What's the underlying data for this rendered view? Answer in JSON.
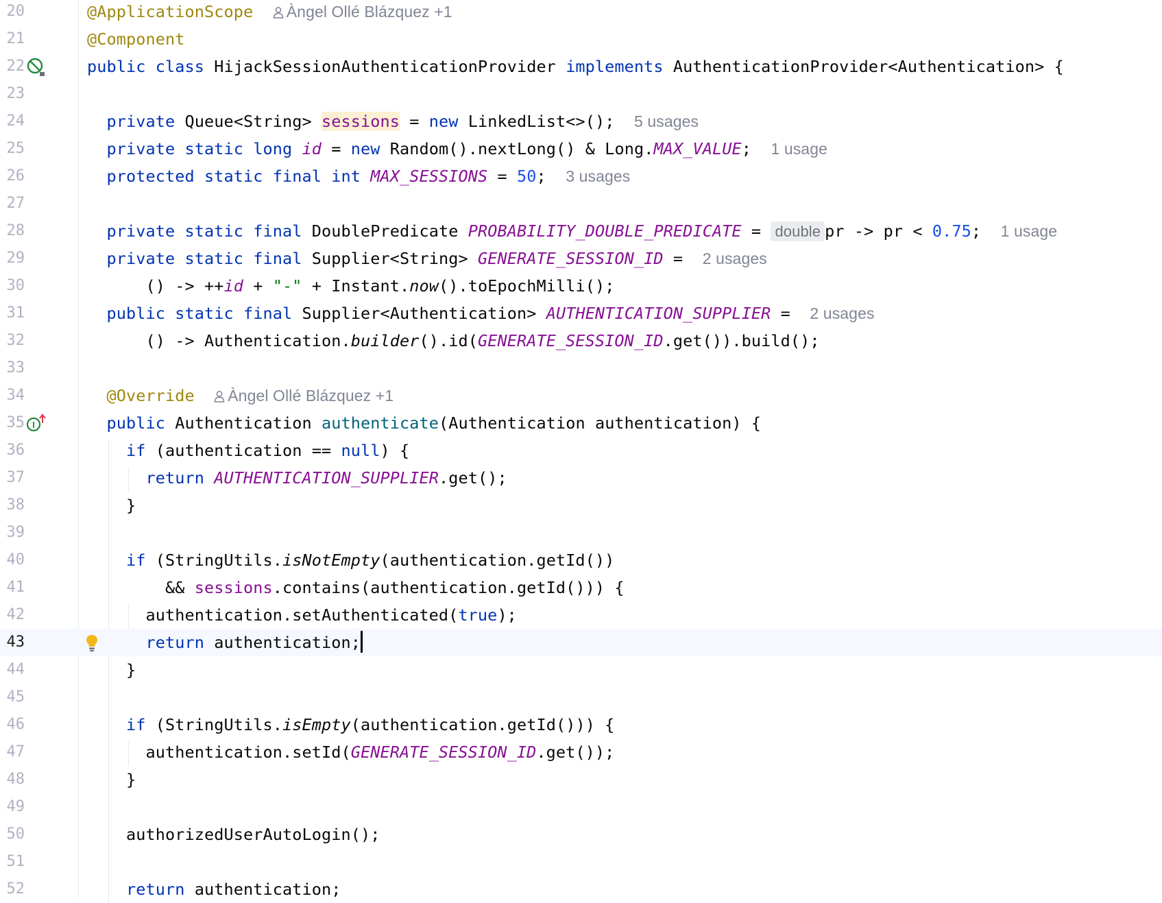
{
  "editor": {
    "current_line": 43,
    "colors": {
      "keyword": "#0033b3",
      "annotation": "#9e880d",
      "field": "#871094",
      "number": "#1750eb",
      "string": "#067d17",
      "method_declaration": "#00627a",
      "hint": "#818594",
      "current_line_background": "#f5f8fe"
    },
    "gutter_icons": {
      "line_22": "no-beans-icon",
      "line_35": "implements-method-icon",
      "line_43": "intention-bulb-icon"
    },
    "lines": [
      {
        "n": "20",
        "tokens": [
          {
            "t": "@ApplicationScope",
            "c": "ann"
          },
          {
            "t": "  "
          },
          {
            "t": "Àngel Ollé Blázquez +1",
            "c": "hint",
            "icon": "person-icon"
          }
        ]
      },
      {
        "n": "21",
        "tokens": [
          {
            "t": "@Component",
            "c": "ann"
          }
        ]
      },
      {
        "n": "22",
        "tokens": [
          {
            "t": "public",
            "c": "kw"
          },
          {
            "t": " "
          },
          {
            "t": "class",
            "c": "kw"
          },
          {
            "t": " HijackSessionAuthenticationProvider "
          },
          {
            "t": "implements",
            "c": "kw"
          },
          {
            "t": " AuthenticationProvider<Authentication> {"
          }
        ]
      },
      {
        "n": "23",
        "tokens": []
      },
      {
        "n": "24",
        "tokens": [
          {
            "t": "  "
          },
          {
            "t": "private",
            "c": "kw"
          },
          {
            "t": " Queue<String> "
          },
          {
            "t": "sessions",
            "c": "field hl-field"
          },
          {
            "t": " = "
          },
          {
            "t": "new",
            "c": "kw"
          },
          {
            "t": " LinkedList<>();  "
          },
          {
            "t": "5 usages",
            "c": "hint"
          }
        ]
      },
      {
        "n": "25",
        "tokens": [
          {
            "t": "  "
          },
          {
            "t": "private",
            "c": "kw"
          },
          {
            "t": " "
          },
          {
            "t": "static",
            "c": "kw"
          },
          {
            "t": " "
          },
          {
            "t": "long",
            "c": "kw"
          },
          {
            "t": " "
          },
          {
            "t": "id",
            "c": "sfield"
          },
          {
            "t": " = "
          },
          {
            "t": "new",
            "c": "kw"
          },
          {
            "t": " Random().nextLong() & Long."
          },
          {
            "t": "MAX_VALUE",
            "c": "sfield"
          },
          {
            "t": ";  "
          },
          {
            "t": "1 usage",
            "c": "hint"
          }
        ]
      },
      {
        "n": "26",
        "tokens": [
          {
            "t": "  "
          },
          {
            "t": "protected",
            "c": "kw"
          },
          {
            "t": " "
          },
          {
            "t": "static",
            "c": "kw"
          },
          {
            "t": " "
          },
          {
            "t": "final",
            "c": "kw"
          },
          {
            "t": " "
          },
          {
            "t": "int",
            "c": "kw"
          },
          {
            "t": " "
          },
          {
            "t": "MAX_SESSIONS",
            "c": "sfield"
          },
          {
            "t": " = "
          },
          {
            "t": "50",
            "c": "num"
          },
          {
            "t": ";  "
          },
          {
            "t": "3 usages",
            "c": "hint"
          }
        ]
      },
      {
        "n": "27",
        "tokens": []
      },
      {
        "n": "28",
        "tokens": [
          {
            "t": "  "
          },
          {
            "t": "private",
            "c": "kw"
          },
          {
            "t": " "
          },
          {
            "t": "static",
            "c": "kw"
          },
          {
            "t": " "
          },
          {
            "t": "final",
            "c": "kw"
          },
          {
            "t": " DoublePredicate "
          },
          {
            "t": "PROBABILITY_DOUBLE_PREDICATE",
            "c": "sfield"
          },
          {
            "t": " = "
          },
          {
            "t": "double",
            "c": "inlay"
          },
          {
            "t": "pr -> pr < "
          },
          {
            "t": "0.75",
            "c": "num"
          },
          {
            "t": ";  "
          },
          {
            "t": "1 usage",
            "c": "hint"
          }
        ]
      },
      {
        "n": "29",
        "tokens": [
          {
            "t": "  "
          },
          {
            "t": "private",
            "c": "kw"
          },
          {
            "t": " "
          },
          {
            "t": "static",
            "c": "kw"
          },
          {
            "t": " "
          },
          {
            "t": "final",
            "c": "kw"
          },
          {
            "t": " Supplier<String> "
          },
          {
            "t": "GENERATE_SESSION_ID",
            "c": "sfield"
          },
          {
            "t": " =  "
          },
          {
            "t": "2 usages",
            "c": "hint"
          }
        ]
      },
      {
        "n": "30",
        "tokens": [
          {
            "t": "      () -> ++"
          },
          {
            "t": "id",
            "c": "sfield"
          },
          {
            "t": " + "
          },
          {
            "t": "\"-\"",
            "c": "str"
          },
          {
            "t": " + Instant."
          },
          {
            "t": "now",
            "c": "ital"
          },
          {
            "t": "().toEpochMilli();"
          }
        ]
      },
      {
        "n": "31",
        "tokens": [
          {
            "t": "  "
          },
          {
            "t": "public",
            "c": "kw"
          },
          {
            "t": " "
          },
          {
            "t": "static",
            "c": "kw"
          },
          {
            "t": " "
          },
          {
            "t": "final",
            "c": "kw"
          },
          {
            "t": " Supplier<Authentication> "
          },
          {
            "t": "AUTHENTICATION_SUPPLIER",
            "c": "sfield"
          },
          {
            "t": " =  "
          },
          {
            "t": "2 usages",
            "c": "hint"
          }
        ]
      },
      {
        "n": "32",
        "tokens": [
          {
            "t": "      () -> Authentication."
          },
          {
            "t": "builder",
            "c": "ital"
          },
          {
            "t": "().id("
          },
          {
            "t": "GENERATE_SESSION_ID",
            "c": "sfield"
          },
          {
            "t": ".get()).build();"
          }
        ]
      },
      {
        "n": "33",
        "tokens": []
      },
      {
        "n": "34",
        "tokens": [
          {
            "t": "  "
          },
          {
            "t": "@Override",
            "c": "ann"
          },
          {
            "t": "  "
          },
          {
            "t": "Àngel Ollé Blázquez +1",
            "c": "hint",
            "icon": "person-icon"
          }
        ]
      },
      {
        "n": "35",
        "tokens": [
          {
            "t": "  "
          },
          {
            "t": "public",
            "c": "kw"
          },
          {
            "t": " Authentication "
          },
          {
            "t": "authenticate",
            "c": "mdecl"
          },
          {
            "t": "(Authentication authentication) {"
          }
        ]
      },
      {
        "n": "36",
        "tokens": [
          {
            "t": "    "
          },
          {
            "t": "if",
            "c": "kw"
          },
          {
            "t": " (authentication == "
          },
          {
            "t": "null",
            "c": "kw"
          },
          {
            "t": ") {"
          }
        ]
      },
      {
        "n": "37",
        "tokens": [
          {
            "t": "      "
          },
          {
            "t": "return",
            "c": "kw"
          },
          {
            "t": " "
          },
          {
            "t": "AUTHENTICATION_SUPPLIER",
            "c": "sfield"
          },
          {
            "t": ".get();"
          }
        ]
      },
      {
        "n": "38",
        "tokens": [
          {
            "t": "    }"
          }
        ]
      },
      {
        "n": "39",
        "tokens": []
      },
      {
        "n": "40",
        "tokens": [
          {
            "t": "    "
          },
          {
            "t": "if",
            "c": "kw"
          },
          {
            "t": " (StringUtils."
          },
          {
            "t": "isNotEmpty",
            "c": "ital"
          },
          {
            "t": "(authentication.getId())"
          }
        ]
      },
      {
        "n": "41",
        "tokens": [
          {
            "t": "        && "
          },
          {
            "t": "sessions",
            "c": "field"
          },
          {
            "t": ".contains(authentication.getId())) {"
          }
        ]
      },
      {
        "n": "42",
        "tokens": [
          {
            "t": "      authentication.setAuthenticated("
          },
          {
            "t": "true",
            "c": "kw"
          },
          {
            "t": ");"
          }
        ]
      },
      {
        "n": "43",
        "tokens": [
          {
            "t": "      "
          },
          {
            "t": "return",
            "c": "kw"
          },
          {
            "t": " authentication;"
          },
          {
            "caret": true
          }
        ]
      },
      {
        "n": "44",
        "tokens": [
          {
            "t": "    }"
          }
        ]
      },
      {
        "n": "45",
        "tokens": []
      },
      {
        "n": "46",
        "tokens": [
          {
            "t": "    "
          },
          {
            "t": "if",
            "c": "kw"
          },
          {
            "t": " (StringUtils."
          },
          {
            "t": "isEmpty",
            "c": "ital"
          },
          {
            "t": "(authentication.getId())) {"
          }
        ]
      },
      {
        "n": "47",
        "tokens": [
          {
            "t": "      authentication.setId("
          },
          {
            "t": "GENERATE_SESSION_ID",
            "c": "sfield"
          },
          {
            "t": ".get());"
          }
        ]
      },
      {
        "n": "48",
        "tokens": [
          {
            "t": "    }"
          }
        ]
      },
      {
        "n": "49",
        "tokens": []
      },
      {
        "n": "50",
        "tokens": [
          {
            "t": "    authorizedUserAutoLogin();"
          }
        ]
      },
      {
        "n": "51",
        "tokens": []
      },
      {
        "n": "52",
        "tokens": [
          {
            "t": "    "
          },
          {
            "t": "return",
            "c": "kw"
          },
          {
            "t": " authentication;"
          }
        ]
      }
    ]
  }
}
